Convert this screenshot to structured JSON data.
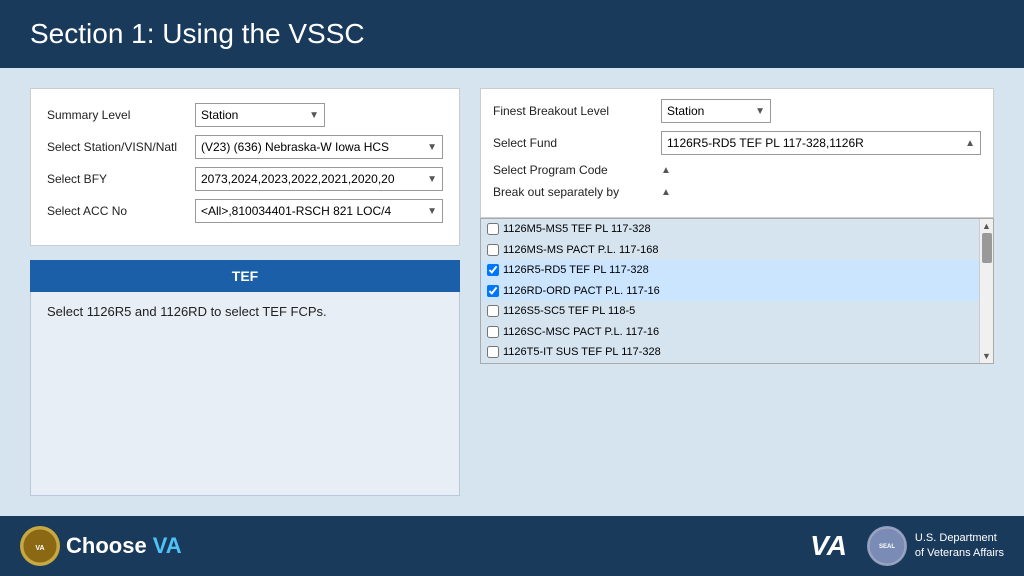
{
  "header": {
    "title": "Section 1: Using the VSSC"
  },
  "form": {
    "summary_level_label": "Summary Level",
    "summary_level_value": "Station",
    "station_visn_label": "Select Station/VISN/Natl",
    "station_visn_value": "(V23) (636) Nebraska-W Iowa HCS",
    "bfy_label": "Select BFY",
    "bfy_value": "2073,2024,2023,2022,2021,2020,20",
    "acc_no_label": "Select ACC No",
    "acc_no_value": "<All>,810034401-RSCH 821 LOC/4",
    "finest_breakout_label": "Finest Breakout Level",
    "finest_breakout_value": "Station",
    "select_fund_label": "Select Fund",
    "select_fund_value": "1126R5-RD5 TEF PL 117-328,1126R",
    "select_program_label": "Select Program Code",
    "break_out_label": "Break out separately by",
    "dropdown_items": [
      {
        "id": "item1",
        "label": "1126M5-MS5 TEF PL 117-328",
        "checked": false
      },
      {
        "id": "item2",
        "label": "1126MS-MS PACT P.L. 117-168",
        "checked": false
      },
      {
        "id": "item3",
        "label": "1126R5-RD5 TEF PL 117-328",
        "checked": true
      },
      {
        "id": "item4",
        "label": "1126RD-ORD PACT P.L. 117-16",
        "checked": true
      },
      {
        "id": "item5",
        "label": "1126S5-SC5 TEF PL 118-5",
        "checked": false
      },
      {
        "id": "item6",
        "label": "1126SC-MSC PACT P.L. 117-16",
        "checked": false
      },
      {
        "id": "item7",
        "label": "1126T5-IT SUS TEF PL 117-328",
        "checked": false
      }
    ]
  },
  "info_box": {
    "title": "TEF",
    "body": "Select 1126R5 and 1126RD to select TEF FCPs."
  },
  "footer": {
    "choose_label": "Choose",
    "va_label": "VA",
    "dept_line1": "U.S. Department",
    "dept_line2": "of Veterans Affairs"
  }
}
